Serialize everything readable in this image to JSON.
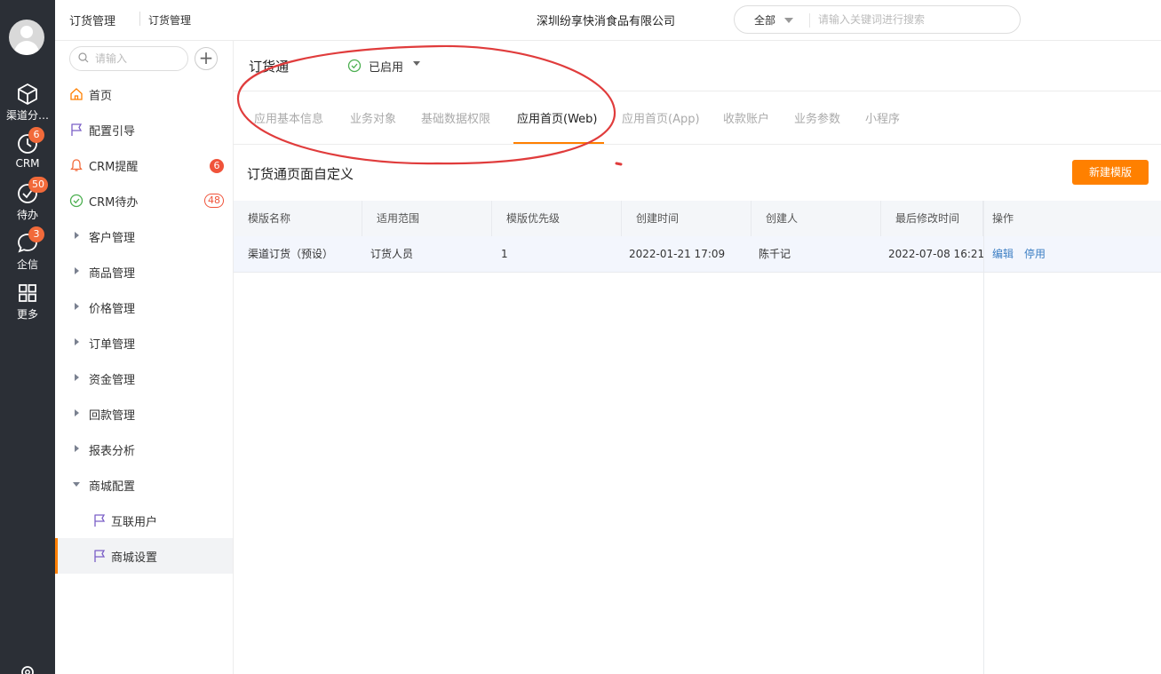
{
  "rail": {
    "items": [
      {
        "label": "渠道分…",
        "icon": "cube-icon"
      },
      {
        "label": "CRM",
        "icon": "clock-icon",
        "badge": "6"
      },
      {
        "label": "待办",
        "icon": "check-circle-icon",
        "badge": "50"
      },
      {
        "label": "企信",
        "icon": "chat-icon",
        "badge": "3"
      },
      {
        "label": "更多",
        "icon": "grid-icon"
      }
    ]
  },
  "header": {
    "crumb_primary": "订货管理",
    "crumb_secondary": "订货管理",
    "company": "深圳纷享快消食品有限公司",
    "search_scope": "全部",
    "search_placeholder": "请输入关键词进行搜索"
  },
  "sidenav": {
    "search_placeholder": "请输入",
    "items": [
      {
        "label": "首页",
        "icon": "home-icon"
      },
      {
        "label": "配置引导",
        "icon": "flag-icon"
      },
      {
        "label": "CRM提醒",
        "icon": "bell-icon",
        "badge": "6"
      },
      {
        "label": "CRM待办",
        "icon": "check-circle-icon",
        "badge": "48"
      },
      {
        "label": "客户管理",
        "icon": "caret-right-icon"
      },
      {
        "label": "商品管理",
        "icon": "caret-right-icon"
      },
      {
        "label": "价格管理",
        "icon": "caret-right-icon"
      },
      {
        "label": "订单管理",
        "icon": "caret-right-icon"
      },
      {
        "label": "资金管理",
        "icon": "caret-right-icon"
      },
      {
        "label": "回款管理",
        "icon": "caret-right-icon"
      },
      {
        "label": "报表分析",
        "icon": "caret-right-icon"
      },
      {
        "label": "商城配置",
        "icon": "caret-down-icon"
      },
      {
        "label": "互联用户",
        "icon": "flag-icon"
      },
      {
        "label": "商城设置",
        "icon": "flag-icon"
      }
    ]
  },
  "main": {
    "app_title": "订货通",
    "status": "已启用",
    "tabs": [
      {
        "label": "应用基本信息"
      },
      {
        "label": "业务对象"
      },
      {
        "label": "基础数据权限"
      },
      {
        "label": "应用首页(Web)"
      },
      {
        "label": "应用首页(App)"
      },
      {
        "label": "收款账户"
      },
      {
        "label": "业务参数"
      },
      {
        "label": "小程序"
      }
    ],
    "section_title": "订货通页面自定义",
    "new_button": "新建模版",
    "table": {
      "columns": [
        "模版名称",
        "适用范围",
        "模版优先级",
        "创建时间",
        "创建人",
        "最后修改时间",
        "操作"
      ],
      "rows": [
        {
          "name": "渠道订货（预设）",
          "scope": "订货人员",
          "priority": "1",
          "created_at": "2022-01-21 17:09",
          "creator": "陈千记",
          "modified_at": "2022-07-08 16:21",
          "actions": [
            "编辑",
            "停用"
          ]
        }
      ]
    }
  },
  "colors": {
    "accent": "#ff8000",
    "rail_bg": "#2b2f36",
    "badge": "#f26a3a",
    "link": "#3d7fc4",
    "annotation": "#e03c3c"
  }
}
